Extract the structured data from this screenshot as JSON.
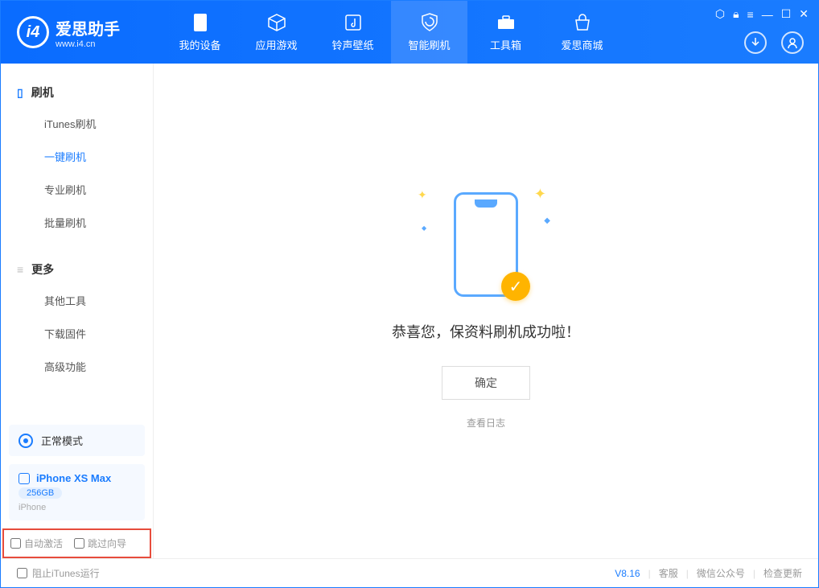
{
  "app": {
    "name": "爱思助手",
    "url": "www.i4.cn"
  },
  "nav": {
    "tabs": [
      {
        "label": "我的设备"
      },
      {
        "label": "应用游戏"
      },
      {
        "label": "铃声壁纸"
      },
      {
        "label": "智能刷机"
      },
      {
        "label": "工具箱"
      },
      {
        "label": "爱思商城"
      }
    ]
  },
  "sidebar": {
    "section1": {
      "title": "刷机",
      "items": [
        "iTunes刷机",
        "一键刷机",
        "专业刷机",
        "批量刷机"
      ]
    },
    "section2": {
      "title": "更多",
      "items": [
        "其他工具",
        "下载固件",
        "高级功能"
      ]
    },
    "mode": "正常模式",
    "device": {
      "name": "iPhone XS Max",
      "capacity": "256GB",
      "type": "iPhone"
    },
    "options": {
      "auto_activate": "自动激活",
      "skip_guide": "跳过向导"
    }
  },
  "main": {
    "success_message": "恭喜您，保资料刷机成功啦！",
    "confirm_button": "确定",
    "log_link": "查看日志"
  },
  "footer": {
    "block_itunes": "阻止iTunes运行",
    "version": "V8.16",
    "links": [
      "客服",
      "微信公众号",
      "检查更新"
    ]
  }
}
